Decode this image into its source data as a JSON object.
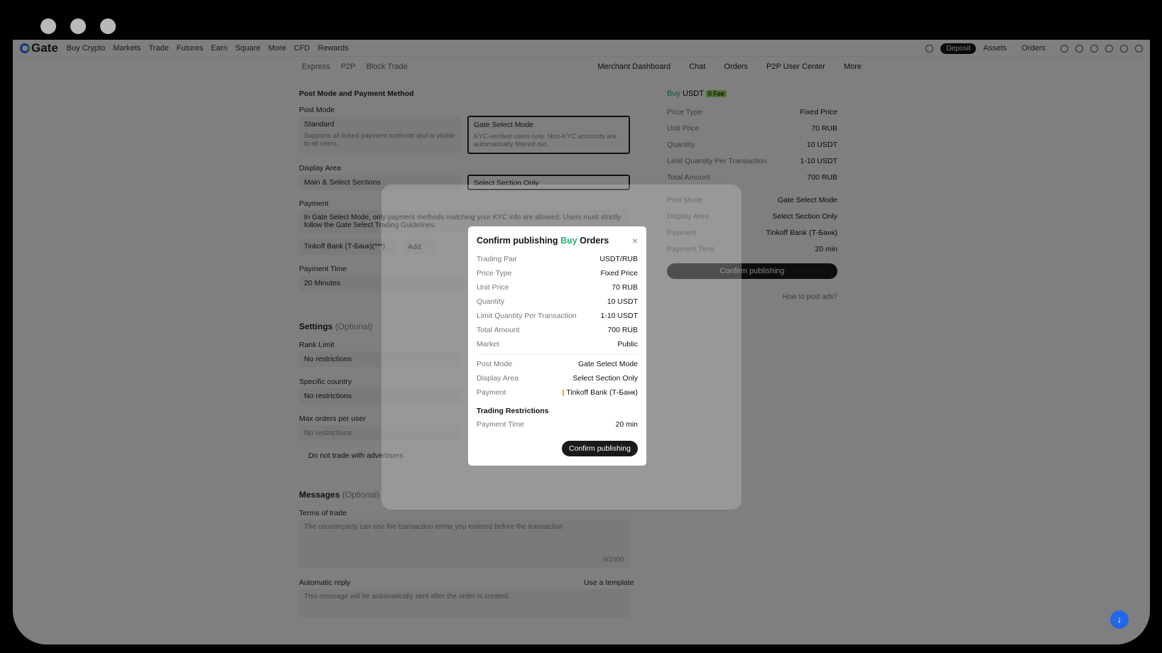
{
  "nav": {
    "brand": "Gate",
    "items": [
      "Buy Crypto",
      "Markets",
      "Trade",
      "Futures",
      "Earn",
      "Square",
      "More",
      "CFD",
      "Rewards"
    ],
    "deposit": "Deposit",
    "assets": "Assets",
    "orders": "Orders"
  },
  "subnav": {
    "tabs": [
      "Express",
      "P2P",
      "Block Trade"
    ],
    "right": [
      "Merchant Dashboard",
      "Chat",
      "Orders",
      "P2P User Center",
      "More"
    ]
  },
  "form": {
    "section_title": "Post Mode and Payment Method",
    "post_mode_label": "Post Mode",
    "standard_title": "Standard",
    "standard_desc": "Supports all linked payment methods and is visible to all users.",
    "gate_select_title": "Gate Select Mode",
    "gate_select_desc": "KYC-verified users only. Non-KYC accounts are automatically filtered out.",
    "display_area_label": "Display Area",
    "display_opt1": "Main & Select Sections",
    "display_opt2": "Select Section Only",
    "payment_label": "Payment",
    "payment_note": "In Gate Select Mode, only payment methods matching your KYC info are allowed. Users must strictly follow the Gate Select Trading Guidelines.",
    "payment_chip": "Tinkoff Bank (Т-Банк)(***)",
    "add": "Add",
    "payment_time_label": "Payment Time",
    "payment_time_value": "20 Minutes",
    "settings_title": "Settings",
    "optional": "(Optional)",
    "rank_limit_label": "Rank Limit",
    "no_restrictions": "No restrictions",
    "specific_country_label": "Specific country",
    "max_orders_label": "Max orders per user",
    "do_not_trade": "Do not trade with advertisers",
    "messages_title": "Messages",
    "terms_label": "Terms of trade",
    "terms_placeholder": "The counterparty can see the transaction terms you entered before the transaction",
    "counter": "0/1000",
    "auto_reply_label": "Automatic reply",
    "use_template": "Use a template",
    "auto_reply_placeholder": "This message will be automatically sent after the order is created."
  },
  "summary": {
    "buy": "Buy",
    "asset": "USDT",
    "fee_badge": "0 Fee",
    "rows": [
      {
        "k": "Price Type",
        "v": "Fixed Price"
      },
      {
        "k": "Unit Price",
        "v": "70 RUB"
      },
      {
        "k": "Quantity",
        "v": "10 USDT"
      },
      {
        "k": "Limit Quantity Per Transaction",
        "v": "1-10 USDT"
      },
      {
        "k": "Total Amount",
        "v": "700 RUB"
      },
      {
        "k": "Post Mode",
        "v": "Gate Select Mode"
      },
      {
        "k": "Display Area",
        "v": "Select Section Only"
      },
      {
        "k": "Payment",
        "v": "Tinkoff Bank (Т-Банк)"
      },
      {
        "k": "Payment Time",
        "v": "20 min"
      }
    ],
    "confirm": "Confirm publishing",
    "how_to": "How to post ads?"
  },
  "modal": {
    "title_pre": "Confirm publishing",
    "title_buy": "Buy",
    "title_post": "Orders",
    "close": "×",
    "rows1": [
      {
        "k": "Trading Pair",
        "v": "USDT/RUB"
      },
      {
        "k": "Price Type",
        "v": "Fixed Price"
      },
      {
        "k": "Unit Price",
        "v": "70 RUB"
      },
      {
        "k": "Quantity",
        "v": "10 USDT"
      },
      {
        "k": "Limit Quantity Per Transaction",
        "v": "1-10 USDT"
      },
      {
        "k": "Total Amount",
        "v": "700 RUB"
      },
      {
        "k": "Market",
        "v": "Public"
      }
    ],
    "rows2": [
      {
        "k": "Post Mode",
        "v": "Gate Select Mode"
      },
      {
        "k": "Display Area",
        "v": "Select Section Only"
      },
      {
        "k": "Payment",
        "v": "Tinkoff Bank (Т-Банк)"
      }
    ],
    "restrictions_title": "Trading Restrictions",
    "rows3": [
      {
        "k": "Payment Time",
        "v": "20 min"
      }
    ],
    "confirm": "Confirm publishing"
  }
}
